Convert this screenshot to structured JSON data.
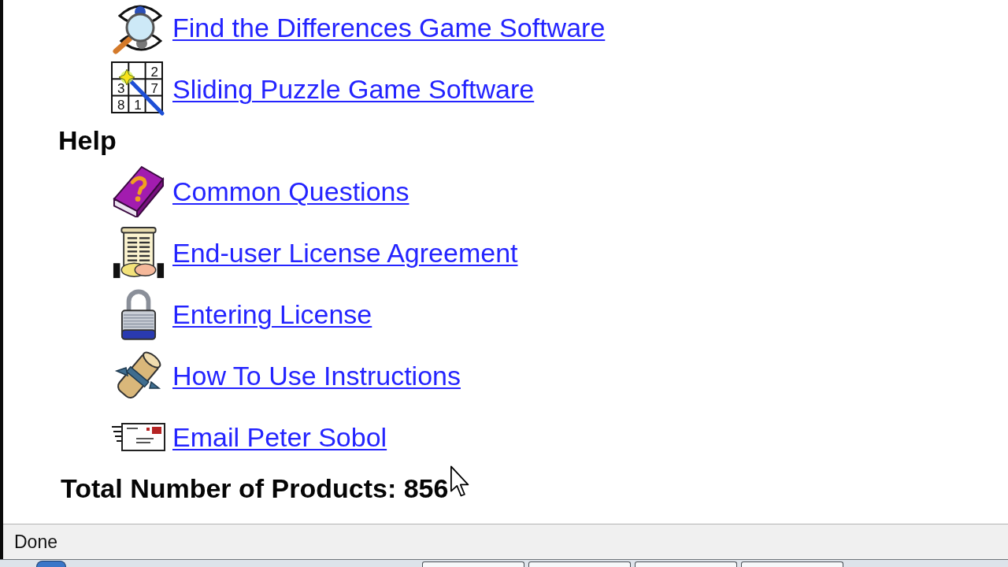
{
  "product_links": [
    {
      "label": "Find the Differences Game Software"
    },
    {
      "label": "Sliding Puzzle Game Software",
      "icon_tiles": [
        "2",
        "3",
        "7",
        "8",
        "1"
      ]
    }
  ],
  "help": {
    "heading": "Help",
    "links": [
      {
        "label": "Common Questions"
      },
      {
        "label": "End-user License Agreement"
      },
      {
        "label": "Entering License"
      },
      {
        "label": "How To Use Instructions"
      },
      {
        "label": "Email Peter Sobol"
      }
    ]
  },
  "total": "Total Number of Products: 856",
  "status_bar": {
    "text": "Done"
  }
}
